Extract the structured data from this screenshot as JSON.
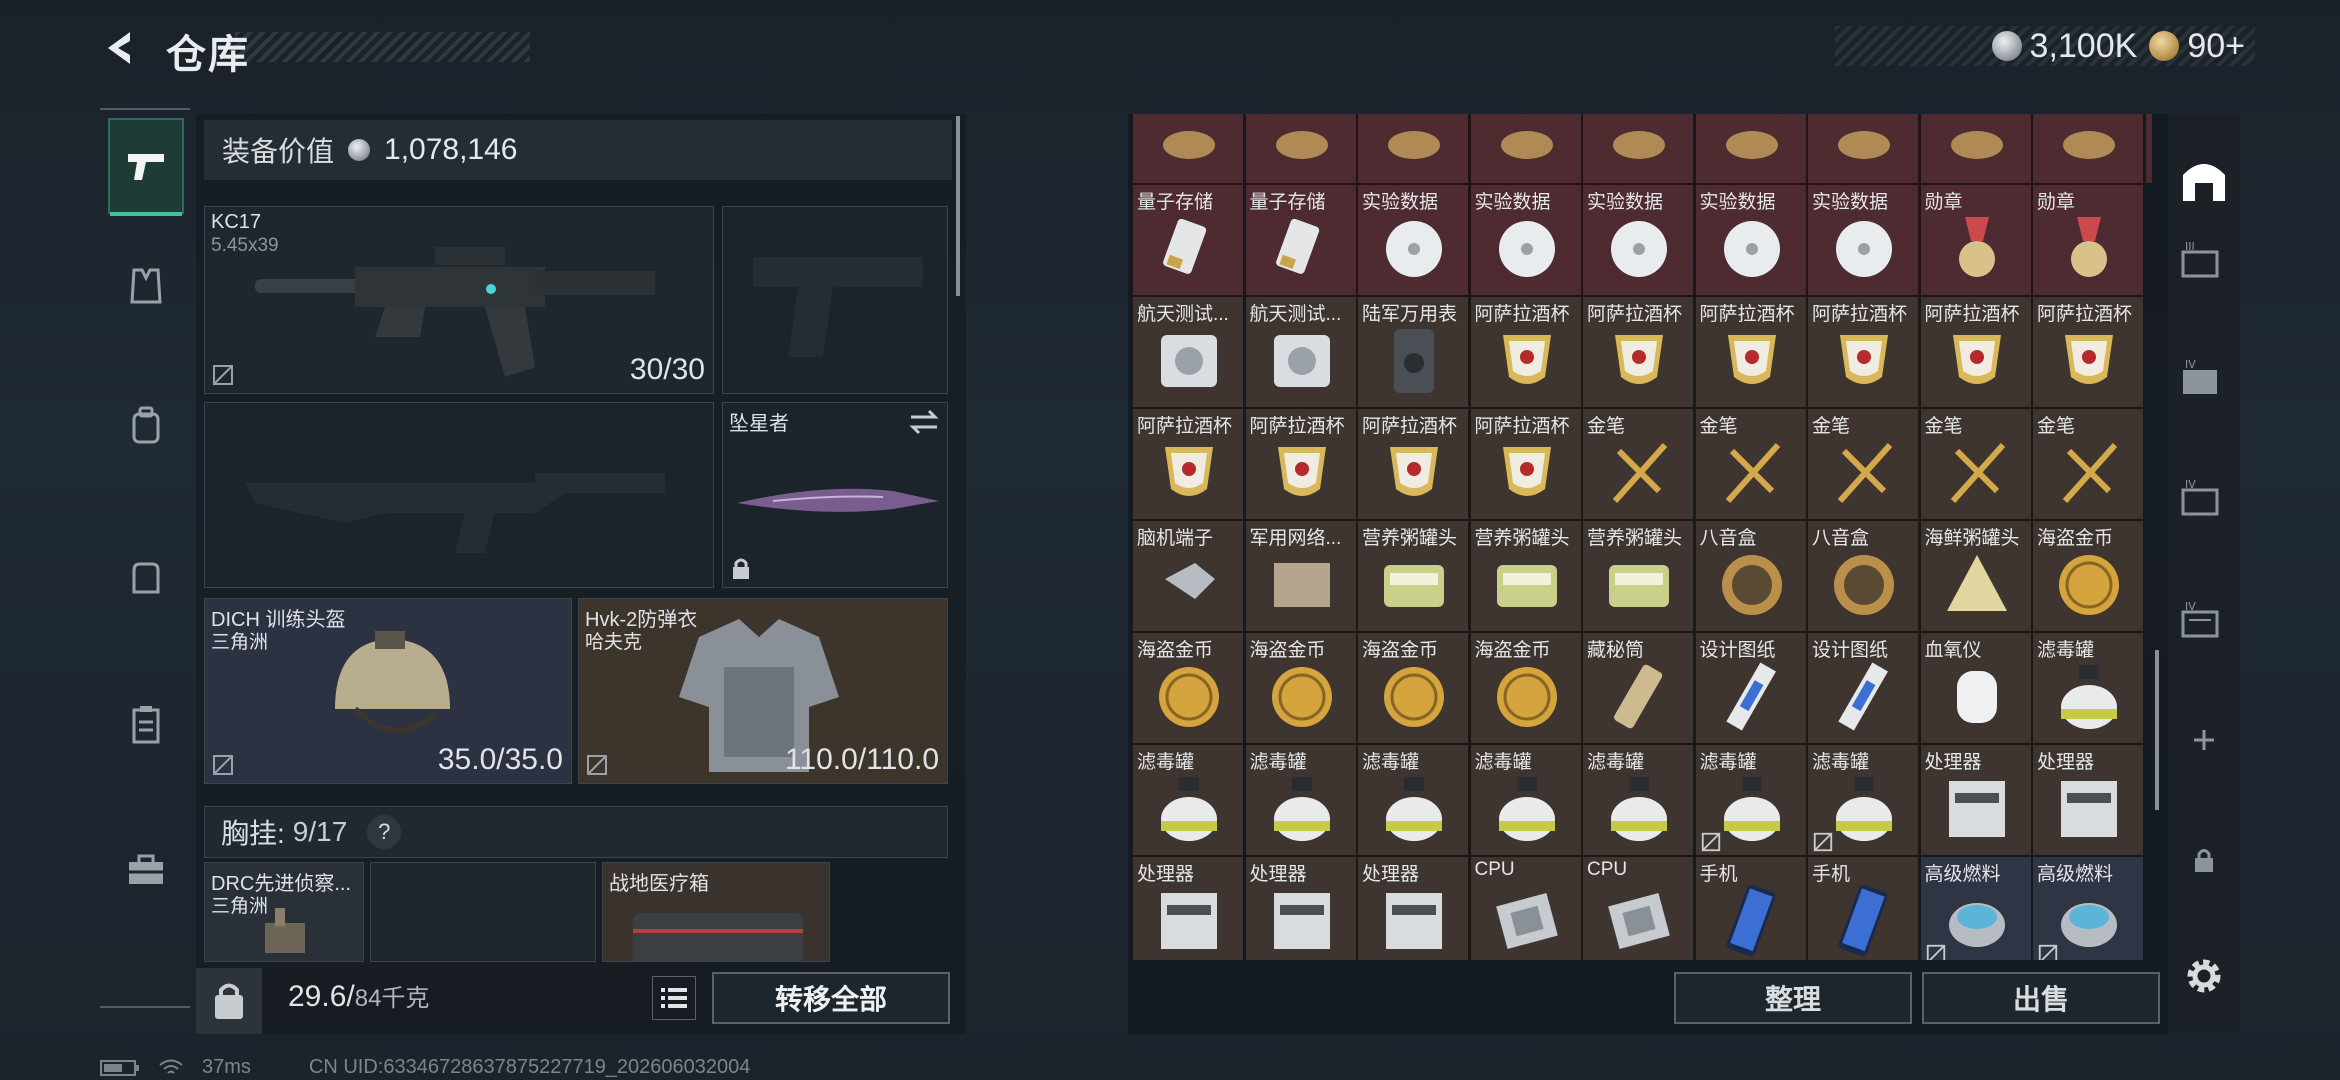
{
  "header": {
    "title": "仓库",
    "currency": [
      {
        "icon": "silver-coin-icon",
        "value": "3,100K"
      },
      {
        "icon": "gold-coin-icon",
        "value": "90+"
      }
    ]
  },
  "left_nav": [
    "weapon-pistol",
    "armor-vest",
    "backpack",
    "bag",
    "clipboard",
    "toolbox"
  ],
  "equipment": {
    "value_label": "装备价值",
    "value": "1,078,146",
    "primary_weapon": {
      "name": "KC17",
      "caliber": "5.45x39",
      "ammo": "30/30"
    },
    "melee": {
      "name": "坠星者"
    },
    "helmet": {
      "name": "DICH 训练头盔",
      "map": "三角洲",
      "durability": "35.0/35.0"
    },
    "armor": {
      "name": "Hvk-2防弹衣",
      "map": "哈夫克",
      "durability": "110.0/110.0"
    },
    "rig_label": "胸挂:",
    "rig_capacity": "9/17",
    "rig_help": "?",
    "rig_items": [
      {
        "name": "DRC先进侦察...",
        "map": "三角洲"
      },
      {
        "name": "",
        "map": ""
      },
      {
        "name": "战地医疗箱",
        "map": ""
      }
    ]
  },
  "bottom": {
    "weight": "29.6/",
    "weight_max": "84千克",
    "transfer_all": "转移全部",
    "sort": "整理",
    "sell": "出售"
  },
  "status": {
    "ping": "37ms",
    "uid": "CN UID:6334672863787522771​9_202606032004"
  },
  "grid_rows": [
    [
      "",
      "",
      "",
      "",
      "",
      "",
      "",
      "",
      "",
      ""
    ],
    [
      "量子存储",
      "量子存储",
      "实验数据",
      "实验数据",
      "实验数据",
      "实验数据",
      "实验数据",
      "勋章",
      "勋章"
    ],
    [
      "航天测试...",
      "航天测试...",
      "陆军万用表",
      "阿萨拉酒杯",
      "阿萨拉酒杯",
      "阿萨拉酒杯",
      "阿萨拉酒杯",
      "阿萨拉酒杯",
      "阿萨拉酒杯"
    ],
    [
      "阿萨拉酒杯",
      "阿萨拉酒杯",
      "阿萨拉酒杯",
      "阿萨拉酒杯",
      "金笔",
      "金笔",
      "金笔",
      "金笔",
      "金笔"
    ],
    [
      "脑机端子",
      "军用网络...",
      "营养粥罐头",
      "营养粥罐头",
      "营养粥罐头",
      "八音盒",
      "八音盒",
      "海鲜粥罐头",
      "海盗金币"
    ],
    [
      "海盗金币",
      "海盗金币",
      "海盗金币",
      "海盗金币",
      "藏秘筒",
      "设计图纸",
      "设计图纸",
      "血氧仪",
      "滤毒罐"
    ],
    [
      "滤毒罐",
      "滤毒罐",
      "滤毒罐",
      "滤毒罐",
      "滤毒罐",
      "滤毒罐",
      "滤毒罐",
      "处理器",
      "处理器"
    ],
    [
      "处理器",
      "处理器",
      "处理器",
      "CPU",
      "CPU",
      "手机",
      "手机",
      "高级燃料",
      "高级燃料"
    ]
  ],
  "colors": {
    "red_cell": "#4e2b31",
    "brown_cell": "#3f3530",
    "blue_cell": "#2f3545",
    "accent": "#3ec39b"
  }
}
